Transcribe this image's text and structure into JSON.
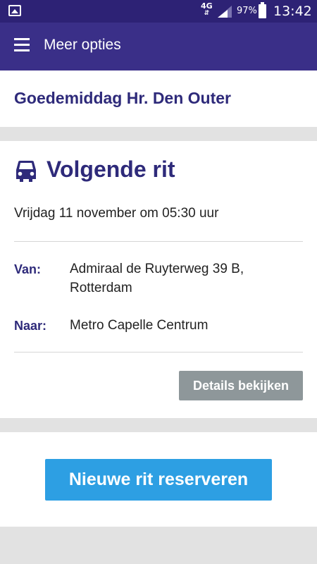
{
  "status_bar": {
    "network": "4G",
    "battery": "97%",
    "time": "13:42",
    "icons": [
      "image-icon",
      "signal-icon",
      "battery-icon"
    ]
  },
  "app_bar": {
    "title": "Meer opties",
    "menu_icon": "hamburger-menu-icon"
  },
  "greeting": "Goedemiddag Hr. Den Outer",
  "next_ride": {
    "icon": "car-icon",
    "title": "Volgende rit",
    "date": "Vrijdag 11 november om 05:30 uur",
    "from_label": "Van:",
    "from_value": "Admiraal de Ruyterweg 39 B, Rotterdam",
    "to_label": "Naar:",
    "to_value": "Metro Capelle Centrum",
    "details_button": "Details bekijken"
  },
  "reserve_button": "Nieuwe rit reserveren",
  "colors": {
    "status_bar": "#2d2275",
    "app_bar": "#3a2f88",
    "accent_text": "#2e2a7a",
    "details_button": "#8e979a",
    "primary_button": "#2d9fe3",
    "background": "#e2e2e2"
  }
}
